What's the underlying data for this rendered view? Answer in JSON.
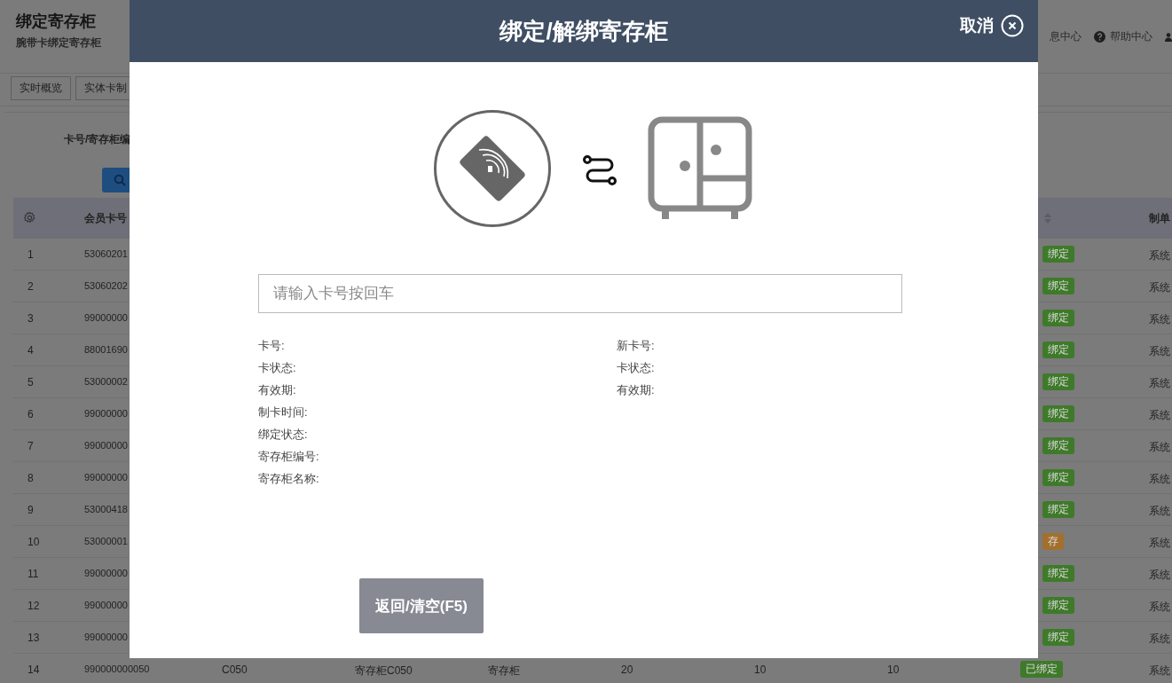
{
  "page": {
    "title": "绑定寄存柜",
    "subtitle": "腕带卡绑定寄存柜",
    "top_links": [
      {
        "kind": "plain",
        "label": "息中心"
      },
      {
        "kind": "help",
        "label": "帮助中心"
      },
      {
        "kind": "user"
      }
    ]
  },
  "tabs": [
    {
      "label": "实时概览",
      "selected": false
    },
    {
      "label": "实体卡制",
      "selected": false
    }
  ],
  "filter": {
    "label": "卡号/寄存柜编"
  },
  "table": {
    "columns": [
      "会员卡号",
      "制单"
    ],
    "rows": [
      {
        "index": "1",
        "card": "53060201",
        "status": "绑定",
        "color": "#3f7a2a",
        "creator": "系统"
      },
      {
        "index": "2",
        "card": "53060202",
        "status": "绑定",
        "color": "#3f7a2a",
        "creator": "系统"
      },
      {
        "index": "3",
        "card": "99000000",
        "status": "绑定",
        "color": "#3f7a2a",
        "creator": "系统"
      },
      {
        "index": "4",
        "card": "88001690",
        "status": "绑定",
        "color": "#3f7a2a",
        "creator": "系统"
      },
      {
        "index": "5",
        "card": "53000002",
        "status": "绑定",
        "color": "#3f7a2a",
        "creator": "系统"
      },
      {
        "index": "6",
        "card": "99000000",
        "status": "绑定",
        "color": "#3f7a2a",
        "creator": "系统"
      },
      {
        "index": "7",
        "card": "99000000",
        "status": "绑定",
        "color": "#3f7a2a",
        "creator": "系统"
      },
      {
        "index": "8",
        "card": "99000000",
        "status": "绑定",
        "color": "#3f7a2a",
        "creator": "系统"
      },
      {
        "index": "9",
        "card": "53000418",
        "status": "绑定",
        "color": "#3f7a2a",
        "creator": "系统"
      },
      {
        "index": "10",
        "card": "53000001",
        "status": "存",
        "color": "#a2702c",
        "creator": "系统"
      },
      {
        "index": "11",
        "card": "99000000",
        "status": "绑定",
        "color": "#3f7a2a",
        "creator": "系统"
      },
      {
        "index": "12",
        "card": "99000000",
        "status": "绑定",
        "color": "#3f7a2a",
        "creator": "系统"
      },
      {
        "index": "13",
        "card": "99000000",
        "status": "绑定",
        "color": "#3f7a2a",
        "creator": "系统"
      },
      {
        "index": "14",
        "card": "990000000050",
        "cells": [
          "C050",
          "寄存柜C050",
          "寄存柜",
          "20",
          "10",
          "10"
        ],
        "status": "已绑定",
        "color": "#3f7a2a",
        "creator": "系统"
      }
    ]
  },
  "dialog": {
    "title": "绑定/解绑寄存柜",
    "cancel": "取消",
    "input": {
      "placeholder": "请输入卡号按回车"
    },
    "left_fields": [
      "卡号:",
      "卡状态:",
      "有效期:",
      "制卡时间:",
      "绑定状态:",
      "寄存柜编号:",
      "寄存柜名称:"
    ],
    "right_fields": [
      "新卡号:",
      "卡状态:",
      "有效期:"
    ],
    "button": "返回/清空(F5)"
  }
}
